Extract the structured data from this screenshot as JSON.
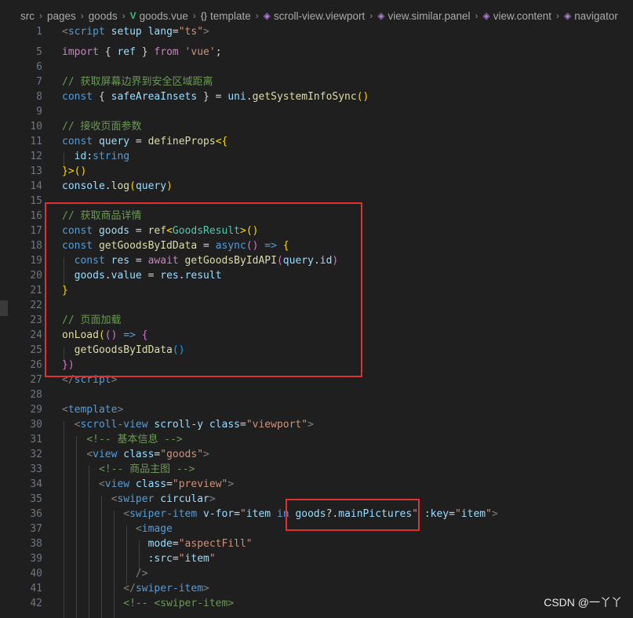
{
  "breadcrumb": {
    "items": [
      {
        "label": "src"
      },
      {
        "label": "pages"
      },
      {
        "label": "goods"
      },
      {
        "label": "goods.vue"
      },
      {
        "label": "template"
      },
      {
        "label": "scroll-view.viewport"
      },
      {
        "label": "view.similar.panel"
      },
      {
        "label": "view.content"
      },
      {
        "label": "navigator"
      }
    ]
  },
  "code": {
    "l1_num": "1",
    "l1_a": "<",
    "l1_b": "script",
    "l1_c": " setup",
    "l1_d": " lang",
    "l1_e": "=",
    "l1_f": "\"ts\"",
    "l1_g": ">",
    "l5_num": "5",
    "l5_a": "import",
    "l5_b": " { ",
    "l5_c": "ref",
    "l5_d": " } ",
    "l5_e": "from",
    "l5_f": " 'vue'",
    "l5_g": ";",
    "l6_num": "6",
    "l7_num": "7",
    "l7_a": "// 获取屏幕边界到安全区域距离",
    "l8_num": "8",
    "l8_a": "const",
    "l8_b": " { ",
    "l8_c": "safeAreaInsets",
    "l8_d": " } = ",
    "l8_e": "uni",
    "l8_f": ".",
    "l8_g": "getSystemInfoSync",
    "l8_h": "()",
    "l9_num": "9",
    "l10_num": "10",
    "l10_a": "// 接收页面参数",
    "l11_num": "11",
    "l11_a": "const",
    "l11_b": " query",
    "l11_c": " = ",
    "l11_d": "defineProps",
    "l11_e": "<{",
    "l12_num": "12",
    "l12_a": "id",
    "l12_b": ":",
    "l12_c": "string",
    "l13_num": "13",
    "l13_a": "}>",
    "l13_b": "()",
    "l14_num": "14",
    "l14_a": "console",
    "l14_b": ".",
    "l14_c": "log",
    "l14_d": "(",
    "l14_e": "query",
    "l14_f": ")",
    "l15_num": "15",
    "l16_num": "16",
    "l16_a": "// 获取商品详情",
    "l17_num": "17",
    "l17_a": "const",
    "l17_b": " goods",
    "l17_c": " = ",
    "l17_d": "ref",
    "l17_e": "<",
    "l17_f": "GoodsResult",
    "l17_g": ">",
    "l17_h": "()",
    "l18_num": "18",
    "l18_a": "const",
    "l18_b": " getGoodsByIdData",
    "l18_c": " = ",
    "l18_d": "async",
    "l18_e": "()",
    "l18_f": " => ",
    "l18_g": "{",
    "l19_num": "19",
    "l19_a": "const",
    "l19_b": " res",
    "l19_c": " = ",
    "l19_d": "await",
    "l19_e": " getGoodsByIdAPI",
    "l19_f": "(",
    "l19_g": "query",
    "l19_h": ".",
    "l19_i": "id",
    "l19_j": ")",
    "l20_num": "20",
    "l20_a": "goods",
    "l20_b": ".",
    "l20_c": "value",
    "l20_d": " = ",
    "l20_e": "res",
    "l20_f": ".",
    "l20_g": "result",
    "l21_num": "21",
    "l21_a": "}",
    "l22_num": "22",
    "l23_num": "23",
    "l23_a": "// 页面加载",
    "l24_num": "24",
    "l24_a": "onLoad",
    "l24_b": "(",
    "l24_c": "()",
    "l24_d": " => ",
    "l24_e": "{",
    "l25_num": "25",
    "l25_a": "getGoodsByIdData",
    "l25_b": "()",
    "l26_num": "26",
    "l26_a": "})",
    "l27_num": "27",
    "l27_a": "</",
    "l27_b": "script",
    "l27_c": ">",
    "l28_num": "28",
    "l29_num": "29",
    "l29_a": "<",
    "l29_b": "template",
    "l29_c": ">",
    "l30_num": "30",
    "l30_a": "<",
    "l30_b": "scroll-view",
    "l30_c": " scroll-y",
    "l30_d": " class",
    "l30_e": "=",
    "l30_f": "\"viewport\"",
    "l30_g": ">",
    "l31_num": "31",
    "l31_a": "<!-- 基本信息 -->",
    "l32_num": "32",
    "l32_a": "<",
    "l32_b": "view",
    "l32_c": " class",
    "l32_d": "=",
    "l32_e": "\"goods\"",
    "l32_f": ">",
    "l33_num": "33",
    "l33_a": "<!-- 商品主图 -->",
    "l34_num": "34",
    "l34_a": "<",
    "l34_b": "view",
    "l34_c": " class",
    "l34_d": "=",
    "l34_e": "\"preview\"",
    "l34_f": ">",
    "l35_num": "35",
    "l35_a": "<",
    "l35_b": "swiper",
    "l35_c": " circular",
    "l35_d": ">",
    "l36_num": "36",
    "l36_a": "<",
    "l36_b": "swiper-item",
    "l36_c": " v-for",
    "l36_d": "=",
    "l36_e": "\"",
    "l36_f": "item",
    "l36_g": " in ",
    "l36_h": "goods",
    "l36_i": "?.",
    "l36_j": "mainPictures",
    "l36_k": "\"",
    "l36_l": " :key",
    "l36_m": "=",
    "l36_n": "\"",
    "l36_o": "item",
    "l36_p": "\"",
    "l36_q": ">",
    "l37_num": "37",
    "l37_a": "<",
    "l37_b": "image",
    "l38_num": "38",
    "l38_a": "mode",
    "l38_b": "=",
    "l38_c": "\"aspectFill\"",
    "l39_num": "39",
    "l39_a": ":src",
    "l39_b": "=",
    "l39_c": "\"",
    "l39_d": "item",
    "l39_e": "\"",
    "l40_num": "40",
    "l40_a": "/>",
    "l41_num": "41",
    "l41_a": "</",
    "l41_b": "swiper-item",
    "l41_c": ">",
    "l42_num": "42",
    "l42_a": "<!-- <swiper-item>"
  },
  "watermark": "CSDN @一丫丫"
}
